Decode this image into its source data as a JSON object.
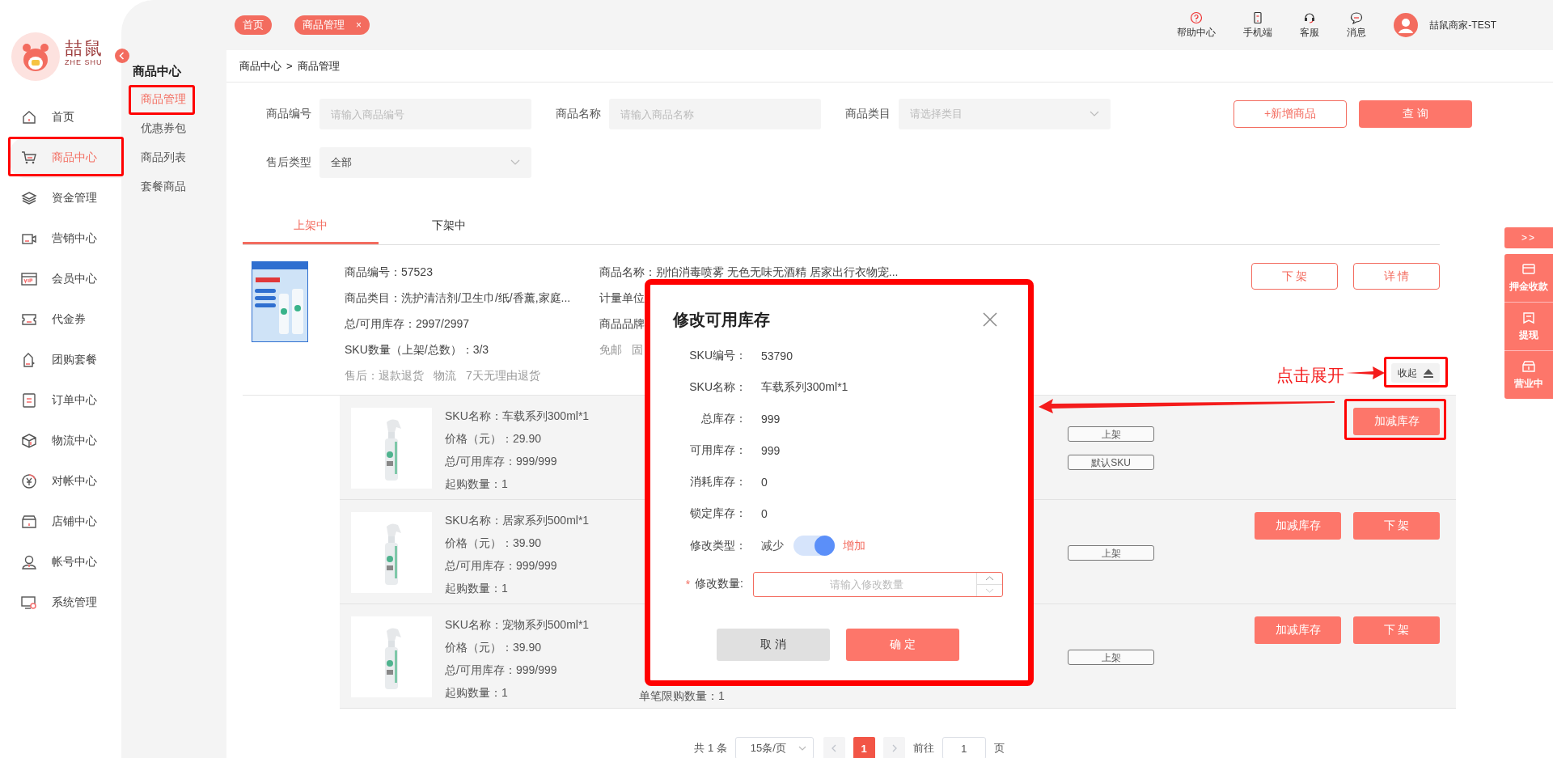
{
  "logo": {
    "name": "喆鼠",
    "subtitle": "ZHE SHU"
  },
  "sidebar": {
    "items": [
      {
        "label": "首页",
        "selected": false
      },
      {
        "label": "商品中心",
        "selected": true
      },
      {
        "label": "资金管理",
        "selected": false
      },
      {
        "label": "营销中心",
        "selected": false
      },
      {
        "label": "会员中心",
        "selected": false
      },
      {
        "label": "代金券",
        "selected": false
      },
      {
        "label": "团购套餐",
        "selected": false
      },
      {
        "label": "订单中心",
        "selected": false
      },
      {
        "label": "物流中心",
        "selected": false
      },
      {
        "label": "对帐中心",
        "selected": false
      },
      {
        "label": "店铺中心",
        "selected": false
      },
      {
        "label": "帐号中心",
        "selected": false
      },
      {
        "label": "系统管理",
        "selected": false
      }
    ]
  },
  "submenu": {
    "title": "商品中心",
    "items": [
      {
        "label": "商品管理",
        "selected": true
      },
      {
        "label": "优惠券包",
        "selected": false
      },
      {
        "label": "商品列表",
        "selected": false
      },
      {
        "label": "套餐商品",
        "selected": false
      }
    ]
  },
  "top_tabs": [
    {
      "label": "首页"
    },
    {
      "label": "商品管理",
      "close": "×"
    }
  ],
  "header_actions": [
    {
      "label": "帮助中心"
    },
    {
      "label": "手机端"
    },
    {
      "label": "客服"
    },
    {
      "label": "消息"
    }
  ],
  "user": {
    "name": "喆鼠商家-TEST"
  },
  "breadcrumb": {
    "items": [
      "商品中心",
      "商品管理"
    ],
    "separator": ">"
  },
  "filters": [
    {
      "label": "商品编号",
      "kind": "input",
      "placeholder": "请输入商品编号"
    },
    {
      "label": "商品名称",
      "kind": "input",
      "placeholder": "请输入商品名称"
    },
    {
      "label": "商品类目",
      "kind": "select",
      "placeholder": "请选择类目"
    },
    {
      "label": "售后类型",
      "kind": "select",
      "value": "全部"
    }
  ],
  "filter_buttons": [
    {
      "label": "+新增商品",
      "kind": "outline"
    },
    {
      "label": "查 询",
      "kind": "primary"
    }
  ],
  "status_tabs": [
    {
      "label": "上架中",
      "selected": true
    },
    {
      "label": "下架中",
      "selected": false
    }
  ],
  "product": {
    "info": [
      "商品编号：57523",
      "商品类目：洗护清洁剂/卫生巾/纸/香薰,家庭...",
      "总/可用库存：2997/2997",
      "SKU数量（上架/总数）：3/3"
    ],
    "after_sale": [
      "售后：退款退货",
      "物流",
      "7天无理由退货"
    ],
    "details": [
      "商品名称：别怕消毒喷雾 无色无味无酒精 居家出行衣物宠...",
      "计量单位",
      "商品品牌"
    ],
    "tags": [
      "免邮",
      "固"
    ],
    "actions": [
      "下 架",
      "详 情"
    ],
    "collapse": "收起"
  },
  "skus": [
    {
      "lines": [
        "SKU名称：车载系列300ml*1",
        "价格（元）：29.90",
        "总/可用库存：999/999",
        "起购数量：1"
      ],
      "tags": [
        "上架",
        "默认SKU"
      ],
      "buttons": [
        "加减库存"
      ]
    },
    {
      "lines": [
        "SKU名称：居家系列500ml*1",
        "价格（元）：39.90",
        "总/可用库存：999/999",
        "起购数量：1"
      ],
      "tags": [
        "上架"
      ],
      "buttons": [
        "加减库存",
        "下 架"
      ]
    },
    {
      "lines": [
        "SKU名称：宠物系列500ml*1",
        "价格（元）：39.90",
        "总/可用库存：999/999",
        "起购数量：1"
      ],
      "extra": "单笔限购数量：1",
      "tags": [
        "上架"
      ],
      "buttons": [
        "加减库存",
        "下 架"
      ]
    }
  ],
  "pagination": {
    "total": "共 1 条",
    "page_size": "15条/页",
    "pages": [
      {
        "label": "1",
        "selected": true
      }
    ],
    "goto_label": "前往",
    "goto_value": "1",
    "goto_suffix": "页"
  },
  "dialog": {
    "title": "修改可用库存",
    "fields": [
      {
        "label": "SKU编号：",
        "value": "53790"
      },
      {
        "label": "SKU名称：",
        "value": "车载系列300ml*1"
      },
      {
        "label": "总库存：",
        "value": "999"
      },
      {
        "label": "可用库存：",
        "value": "999"
      },
      {
        "label": "消耗库存：",
        "value": "0"
      },
      {
        "label": "锁定库存：",
        "value": "0"
      }
    ],
    "type": {
      "label": "修改类型：",
      "off_label": "减少",
      "on_label": "增加",
      "on": true
    },
    "quantity": {
      "label": "修改数量:",
      "required_mark": "*",
      "placeholder": "请输入修改数量"
    },
    "buttons": [
      {
        "label": "取 消",
        "kind": "secondary"
      },
      {
        "label": "确 定",
        "kind": "primary"
      }
    ]
  },
  "annotation": {
    "text": "点击展开"
  },
  "float_panel": {
    "toggle": ">>",
    "items": [
      {
        "label": "押金收款"
      },
      {
        "label": "提现"
      },
      {
        "label": "营业中"
      }
    ]
  }
}
